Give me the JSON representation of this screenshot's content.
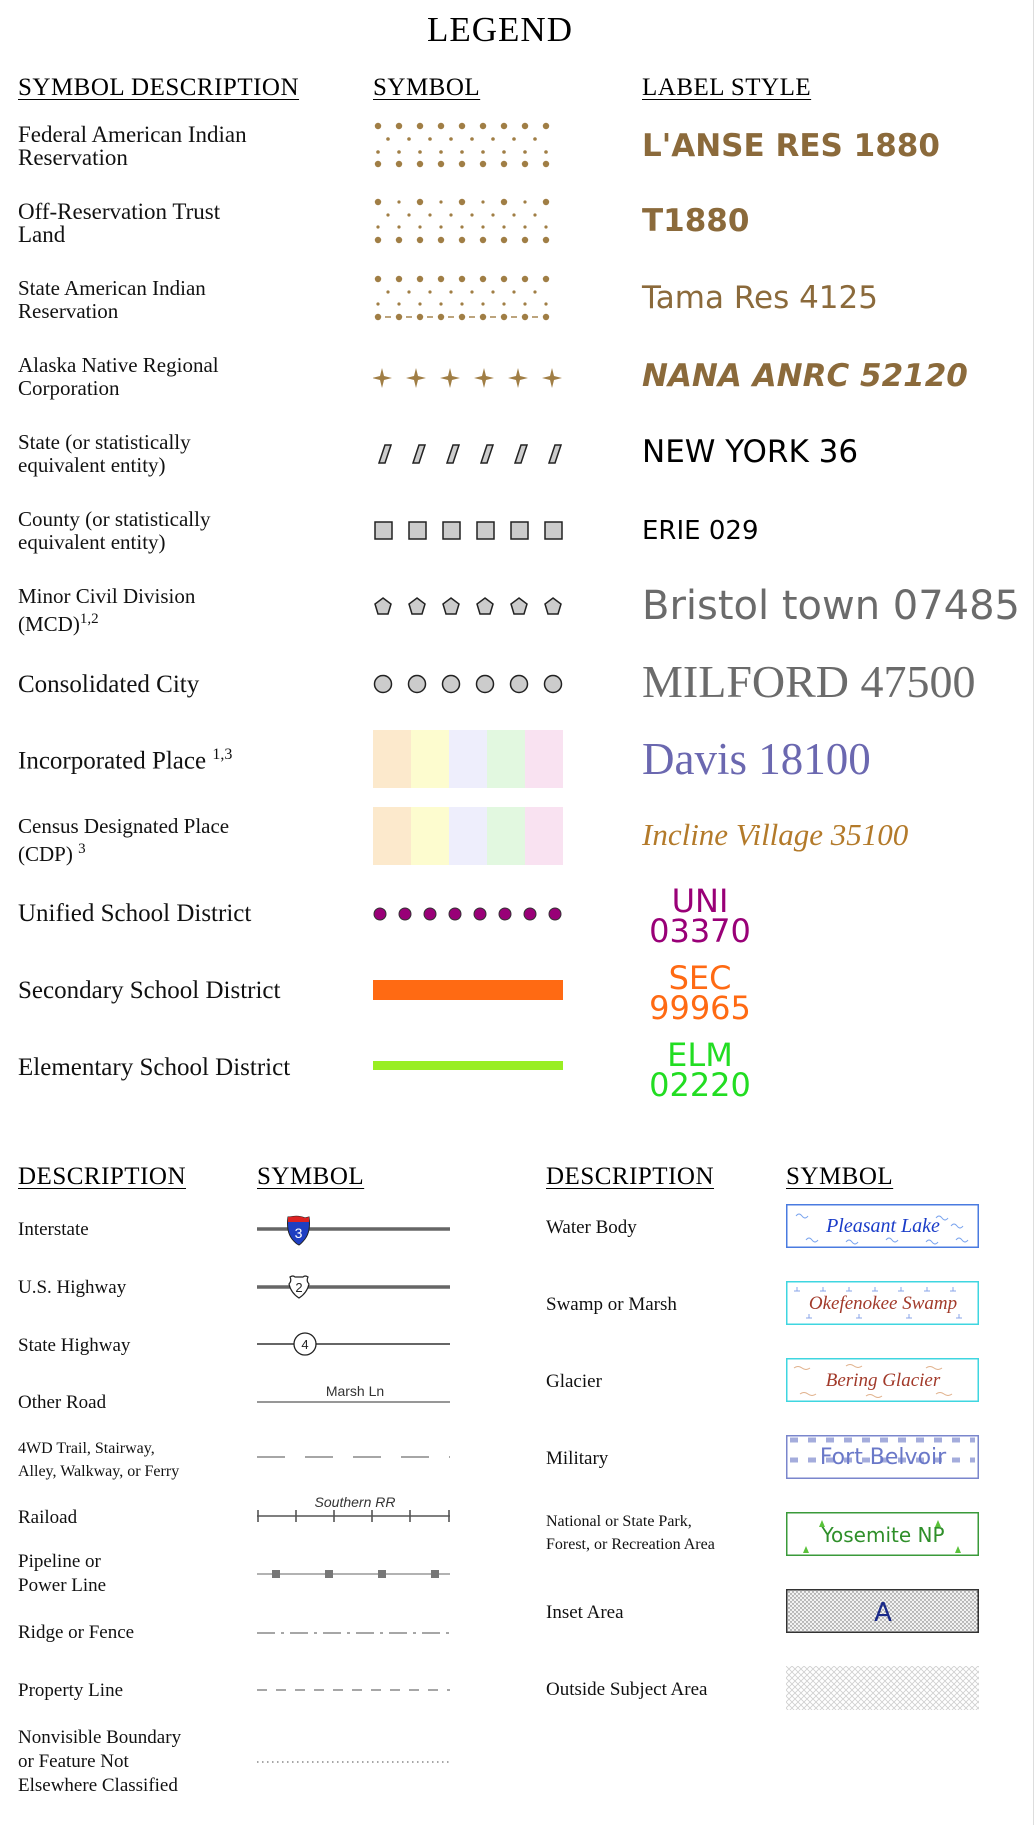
{
  "title": "LEGEND",
  "top_headers": {
    "description": "SYMBOL DESCRIPTION",
    "symbol": "SYMBOL",
    "label_style": "LABEL STYLE"
  },
  "entity_rows": [
    {
      "desc_line1": "Federal American Indian",
      "desc_line2": "Reservation",
      "label": "L'ANSE RES 1880",
      "label_color": "#8b6a3b",
      "symbol": "dots-dense"
    },
    {
      "desc_line1": "Off-Reservation Trust",
      "desc_line2": "Land",
      "label": "T1880",
      "label_color": "#8b6a3b",
      "symbol": "dots-alt"
    },
    {
      "desc_line1": "State American Indian",
      "desc_line2": "Reservation",
      "label": "Tama Res 4125",
      "label_color": "#8b6a3b",
      "symbol": "dots-dash"
    },
    {
      "desc_line1": "Alaska Native Regional",
      "desc_line2": "Corporation",
      "label": "NANA ANRC 52120",
      "label_color": "#8b6a3b",
      "symbol": "crosses"
    },
    {
      "desc_line1": "State (or statistically",
      "desc_line2": "equivalent entity)",
      "label": "NEW YORK 36",
      "label_color": "#000000",
      "symbol": "slashes"
    },
    {
      "desc_line1": "County (or statistically",
      "desc_line2": "equivalent entity)",
      "label": "ERIE 029",
      "label_color": "#000000",
      "symbol": "squares"
    },
    {
      "desc_line1": "Minor Civil Division",
      "desc_line2": "(MCD)",
      "desc_sup": "1,2",
      "label": "Bristol town 07485",
      "label_color": "#6b6b6b",
      "symbol": "pentagons"
    },
    {
      "desc_line1": "Consolidated City",
      "desc_line2": "",
      "label": "MILFORD 47500",
      "label_color": "#6b6b6b",
      "symbol": "circles"
    },
    {
      "desc_line1": "Incorporated Place",
      "desc_line2": "",
      "desc_sup": "1,3",
      "label": "Davis 18100",
      "label_color": "#6b68b0",
      "symbol": "pastel"
    },
    {
      "desc_line1": "Census Designated Place",
      "desc_line2": "(CDP)",
      "desc_sup": "3",
      "label": "Incline Village 35100",
      "label_color": "#b37a2a",
      "symbol": "pastel"
    },
    {
      "desc_line1": "Unified School District",
      "desc_line2": "",
      "label_line1": "UNI",
      "label_line2": "03370",
      "label_color": "#990077",
      "symbol": "magenta-dots"
    },
    {
      "desc_line1": "Secondary School District",
      "desc_line2": "",
      "label_line1": "SEC",
      "label_line2": "99965",
      "label_color": "#ff6a13",
      "symbol": "orange-bar"
    },
    {
      "desc_line1": "Elementary School District",
      "desc_line2": "",
      "label_line1": "ELM",
      "label_line2": "02220",
      "label_color": "#22dd22",
      "symbol": "green-bar"
    }
  ],
  "bottom_headers": {
    "left_description": "DESCRIPTION",
    "left_symbol": "SYMBOL",
    "right_description": "DESCRIPTION",
    "right_symbol": "SYMBOL"
  },
  "roads": [
    {
      "line1": "Interstate",
      "line2": "",
      "shield": "3",
      "symbol": "interstate"
    },
    {
      "line1": "U.S. Highway",
      "line2": "",
      "shield": "2",
      "symbol": "us-highway"
    },
    {
      "line1": "State Highway",
      "line2": "",
      "shield": "4",
      "symbol": "state-highway"
    },
    {
      "line1": "Other Road",
      "line2": "",
      "road_label": "Marsh Ln",
      "symbol": "other-road"
    },
    {
      "line1": "4WD Trail, Stairway,",
      "line2": "Alley, Walkway, or Ferry",
      "symbol": "trail"
    },
    {
      "line1": "Raiload",
      "line2": "",
      "road_label": "Southern RR",
      "symbol": "railroad"
    },
    {
      "line1": "Pipeline or",
      "line2": "Power Line",
      "symbol": "pipeline"
    },
    {
      "line1": "Ridge or Fence",
      "line2": "",
      "symbol": "ridge"
    },
    {
      "line1": "Property Line",
      "line2": "",
      "symbol": "property"
    },
    {
      "line1": "Nonvisible Boundary",
      "line2": "or Feature Not",
      "line3": "Elsewhere Classified",
      "symbol": "nonvisible"
    }
  ],
  "features": [
    {
      "line1": "Water Body",
      "line2": "",
      "box_label": "Pleasant Lake",
      "box_color": "#1a3cc8",
      "border_color": "#4a7be0",
      "symbol": "water"
    },
    {
      "line1": "Swamp or Marsh",
      "line2": "",
      "box_label": "Okefenokee Swamp",
      "box_color": "#a23a2a",
      "border_color": "#3fd6e0",
      "symbol": "swamp"
    },
    {
      "line1": "Glacier",
      "line2": "",
      "box_label": "Bering Glacier",
      "box_color": "#a23a2a",
      "border_color": "#3fd6e0",
      "symbol": "glacier"
    },
    {
      "line1": "Military",
      "line2": "",
      "box_label": "Fort Belvoir",
      "box_color": "#6a78c8",
      "border_color": "#7a86cc",
      "symbol": "military"
    },
    {
      "line1": "National or State Park,",
      "line2": "Forest, or Recreation Area",
      "box_label": "Yosemite NP",
      "box_color": "#2f8f2a",
      "border_color": "#3a9a3a",
      "symbol": "park"
    },
    {
      "line1": "Inset Area",
      "line2": "",
      "box_label": "A",
      "box_color": "#1a2a8a",
      "border_color": "#333333",
      "symbol": "inset"
    },
    {
      "line1": "Outside Subject Area",
      "line2": "",
      "box_label": "",
      "symbol": "outside"
    }
  ]
}
